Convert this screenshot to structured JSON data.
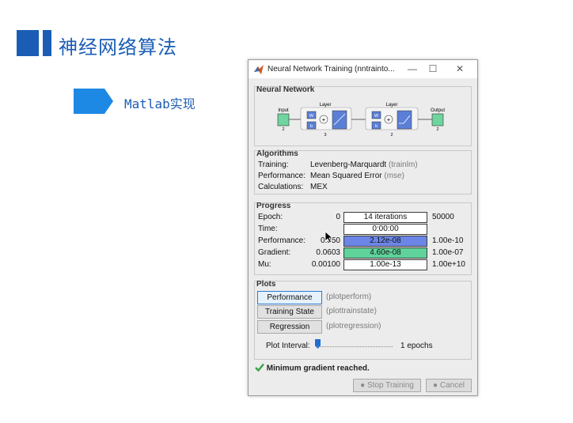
{
  "slide": {
    "title": "神经网络算法",
    "subtitle": "Matlab实现"
  },
  "window": {
    "title": "Neural Network Training (nntrainto...",
    "sections": {
      "network": "Neural Network",
      "algorithms": "Algorithms",
      "progress": "Progress",
      "plots": "Plots"
    },
    "diagram": {
      "input_label": "Input",
      "input_size": "2",
      "layer1_label": "Layer",
      "layer1_size": "3",
      "layer2_label": "Layer",
      "layer2_size": "2",
      "output_label": "Output",
      "output_size": "2",
      "w_label": "W",
      "b_label": "b",
      "plus": "+"
    },
    "algorithms": [
      {
        "label": "Training:",
        "value": "Levenberg-Marquardt",
        "code": "(trainlm)"
      },
      {
        "label": "Performance:",
        "value": "Mean Squared Error",
        "code": "(mse)"
      },
      {
        "label": "Calculations:",
        "value": "MEX",
        "code": ""
      }
    ],
    "progress": [
      {
        "label": "Epoch:",
        "start": "0",
        "current": "14 iterations",
        "end": "50000",
        "fill": 0.0,
        "color": "#ffffff"
      },
      {
        "label": "Time:",
        "start": "",
        "current": "0:00:00",
        "end": "",
        "fill": 0.0,
        "color": "#ffffff"
      },
      {
        "label": "Performance:",
        "start": "0.350",
        "current": "2.12e-08",
        "end": "1.00e-10",
        "fill": 1.0,
        "color": "#6b86e6"
      },
      {
        "label": "Gradient:",
        "start": "0.0603",
        "current": "4.60e-08",
        "end": "1.00e-07",
        "fill": 1.0,
        "color": "#5fd39a"
      },
      {
        "label": "Mu:",
        "start": "0.00100",
        "current": "1.00e-13",
        "end": "1.00e+10",
        "fill": 0.0,
        "color": "#ffffff"
      }
    ],
    "plots": [
      {
        "label": "Performance",
        "fn": "(plotperform)"
      },
      {
        "label": "Training State",
        "fn": "(plottrainstate)"
      },
      {
        "label": "Regression",
        "fn": "(plotregression)"
      }
    ],
    "plot_interval": {
      "label": "Plot Interval:",
      "value": "1 epochs",
      "level": 0.0
    },
    "status": "Minimum gradient reached.",
    "buttons": {
      "stop": "Stop Training",
      "cancel": "Cancel"
    },
    "colors": {
      "accent": "#1b5db5",
      "check": "#3aa34a"
    }
  }
}
